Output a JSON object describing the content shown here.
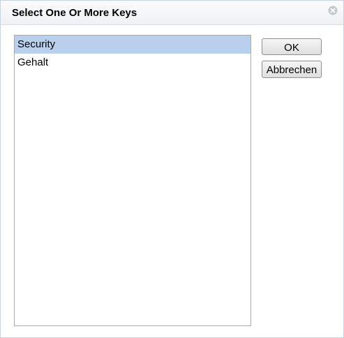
{
  "dialog": {
    "title": "Select One Or More Keys",
    "close_icon": "close-circle-icon"
  },
  "keys_list": {
    "items": [
      {
        "label": "Security",
        "selected": true
      },
      {
        "label": "Gehalt",
        "selected": false
      }
    ]
  },
  "buttons": {
    "ok_label": "OK",
    "cancel_label": "Abbrechen"
  },
  "colors": {
    "selection": "#b8cfee",
    "title_bar": "#eef1f4",
    "border": "#a9a9a9"
  }
}
